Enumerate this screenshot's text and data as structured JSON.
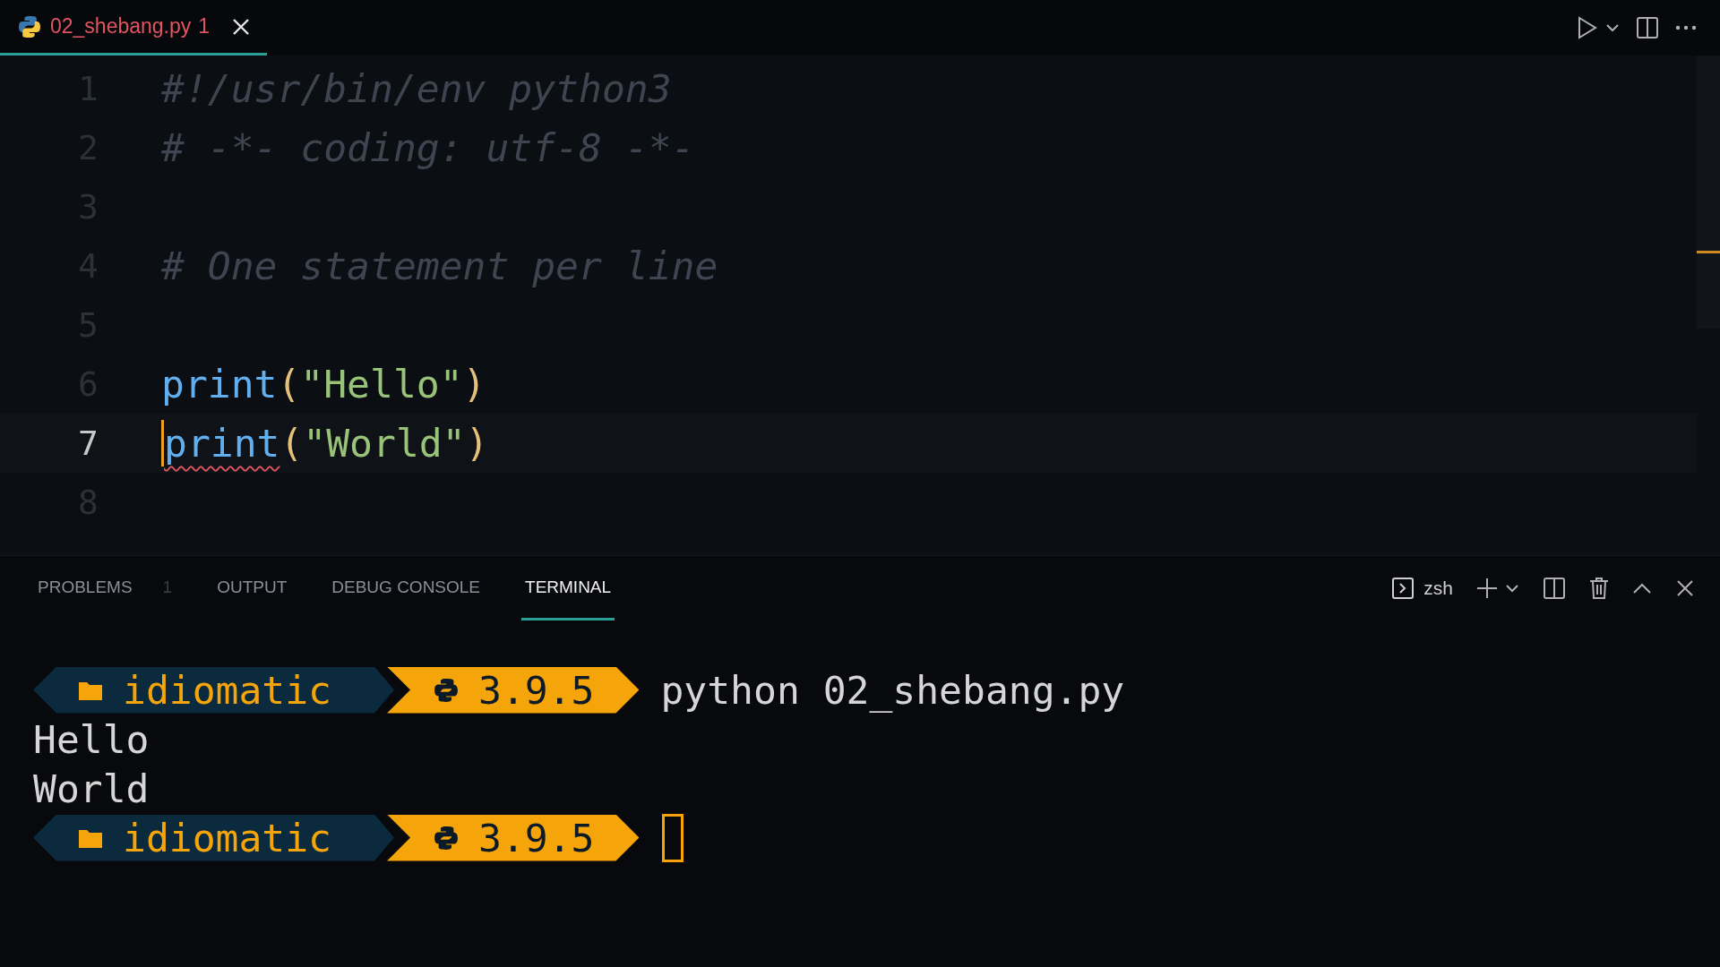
{
  "editor_tabs": [
    {
      "filename": "02_shebang.py",
      "badge": "1",
      "selected": true
    }
  ],
  "editor": {
    "lines": [
      {
        "number": "1",
        "current": false,
        "tokens": [
          {
            "kind": "comment",
            "text": "#!/usr/bin/env python3"
          }
        ]
      },
      {
        "number": "2",
        "current": false,
        "tokens": [
          {
            "kind": "comment",
            "text": "# -*- coding: utf-8 -*-"
          }
        ]
      },
      {
        "number": "3",
        "current": false
      },
      {
        "number": "4",
        "current": false,
        "tokens": [
          {
            "kind": "comment",
            "text": "# One statement per line"
          }
        ]
      },
      {
        "number": "5",
        "current": false
      },
      {
        "number": "6",
        "current": false,
        "tokens": [
          {
            "kind": "function",
            "text": "print",
            "error": false
          },
          {
            "kind": "paren",
            "text": "("
          },
          {
            "kind": "string",
            "text": "\"Hello\""
          },
          {
            "kind": "paren",
            "text": ")"
          }
        ]
      },
      {
        "number": "7",
        "current": true,
        "tokens": [
          {
            "kind": "function",
            "text": "print",
            "error": true
          },
          {
            "kind": "paren",
            "text": "("
          },
          {
            "kind": "string",
            "text": "\"World\""
          },
          {
            "kind": "paren",
            "text": ")"
          }
        ]
      },
      {
        "number": "8",
        "current": false
      }
    ]
  },
  "panel_tabs": [
    {
      "label": "PROBLEMS",
      "badge": "1",
      "selected": false
    },
    {
      "label": "OUTPUT",
      "selected": false
    },
    {
      "label": "DEBUG CONSOLE",
      "selected": false
    },
    {
      "label": "TERMINAL",
      "selected": true
    }
  ],
  "terminal_shell": "zsh",
  "terminal": [
    {
      "kind": "prompt",
      "folder": "idiomatic",
      "version": "3.9.5",
      "command": "python 02_shebang.py",
      "cursor": false
    },
    {
      "kind": "output",
      "text": "Hello"
    },
    {
      "kind": "output",
      "text": "World"
    },
    {
      "kind": "prompt",
      "folder": "idiomatic",
      "version": "3.9.5",
      "cursor": true
    }
  ]
}
